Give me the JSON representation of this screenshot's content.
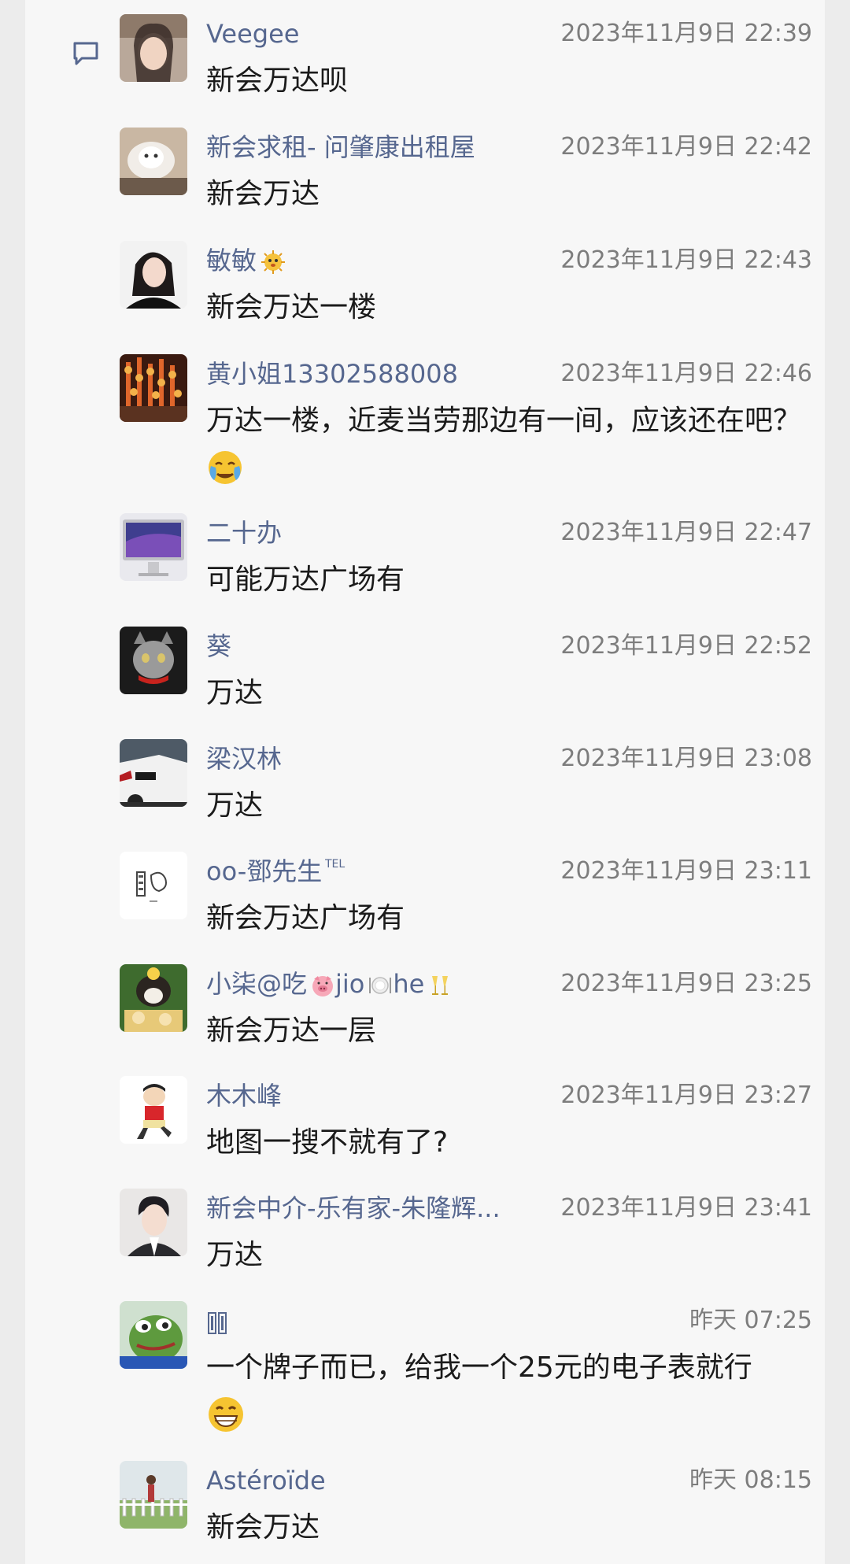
{
  "comments": [
    {
      "name": "Veegee",
      "time": "2023年11月9日 22:39",
      "text": "新会万达呗"
    },
    {
      "name": "新会求租- 问肇康出租屋",
      "time": "2023年11月9日 22:42",
      "text": "新会万达"
    },
    {
      "name": "敏敏",
      "time": "2023年11月9日 22:43",
      "text": "新会万达一楼"
    },
    {
      "name": "黄小姐13302588008",
      "time": "2023年11月9日 22:46",
      "text": "万达一楼，近麦当劳那边有一间，应该还在吧？"
    },
    {
      "name": "二十办",
      "time": "2023年11月9日 22:47",
      "text": "可能万达广场有"
    },
    {
      "name": "葵",
      "time": "2023年11月9日 22:52",
      "text": "万达"
    },
    {
      "name": "梁汉林",
      "time": "2023年11月9日 23:08",
      "text": "万达"
    },
    {
      "name": "oo-鄧先生",
      "time": "2023年11月9日 23:11",
      "text": "新会万达广场有"
    },
    {
      "name_parts": [
        "小柒@吃",
        "jio",
        "he"
      ],
      "time": "2023年11月9日 23:25",
      "text": "新会万达一层"
    },
    {
      "name": "木木峰",
      "time": "2023年11月9日 23:27",
      "text": "地图一搜不就有了?"
    },
    {
      "name": "新会中介-乐有家-朱隆辉...",
      "time": "2023年11月9日 23:41",
      "text": "万达"
    },
    {
      "name": "",
      "time": "昨天 07:25",
      "text": "一个牌子而已，给我一个25元的电子表就行"
    },
    {
      "name": "Astéroïde",
      "time": "昨天 08:15",
      "text": "新会万达"
    }
  ],
  "colors": {
    "name": "#56678f",
    "text": "#1b1b1b",
    "time": "#7d7d7d",
    "background": "#f7f7f7"
  },
  "icons": {
    "header": "comment-icon",
    "emoji_cry": "crying-emoji-icon",
    "emoji_grin": "grinning-emoji-icon",
    "name_deco": [
      "puffer-fish-icon",
      "tel-icon",
      "pig-icon",
      "plate-icon",
      "champagne-icon"
    ]
  }
}
